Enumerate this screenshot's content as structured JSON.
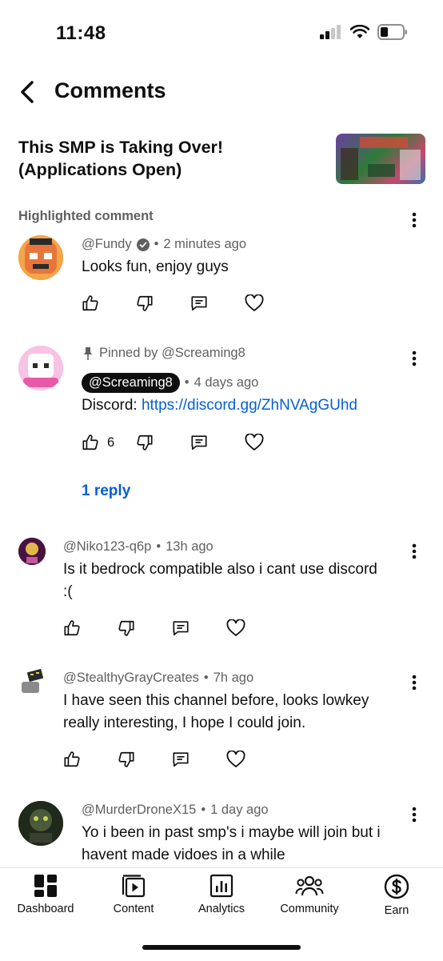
{
  "status_bar": {
    "time": "11:48"
  },
  "header": {
    "title": "Comments"
  },
  "video": {
    "title": "This SMP is Taking Over! (Applications Open)"
  },
  "highlighted_section": {
    "label": "Highlighted comment"
  },
  "comments": [
    {
      "author": "@Fundy",
      "verified": true,
      "time": "2 minutes ago",
      "text": "Looks fun, enjoy guys",
      "likes": ""
    },
    {
      "pinned_label": "Pinned by @Screaming8",
      "author": "@Screaming8",
      "time": "4 days ago",
      "text_prefix": "Discord: ",
      "link": "https://discord.gg/ZhNVAgGUhd",
      "likes": "6",
      "replies": "1 reply"
    },
    {
      "author": "@Niko123-q6p",
      "time": "13h ago",
      "text": "Is it bedrock compatible also i cant use discord :(",
      "likes": ""
    },
    {
      "author": "@StealthyGrayCreates",
      "time": "7h ago",
      "text": "I have seen this channel before, looks lowkey really interesting, I hope I could join.",
      "likes": ""
    },
    {
      "author": "@MurderDroneX15",
      "time": "1 day ago",
      "text": "Yo i been in past smp's i maybe will join but i havent made vidoes in a while",
      "likes": ""
    }
  ],
  "meta_separator": "•",
  "bottom_nav": {
    "items": [
      {
        "label": "Dashboard",
        "icon": "dashboard-icon"
      },
      {
        "label": "Content",
        "icon": "content-icon"
      },
      {
        "label": "Analytics",
        "icon": "analytics-icon"
      },
      {
        "label": "Community",
        "icon": "community-icon"
      },
      {
        "label": "Earn",
        "icon": "earn-icon"
      }
    ]
  },
  "colors": {
    "link": "#065fd4",
    "text": "#0f0f0f",
    "secondary": "#606060"
  }
}
